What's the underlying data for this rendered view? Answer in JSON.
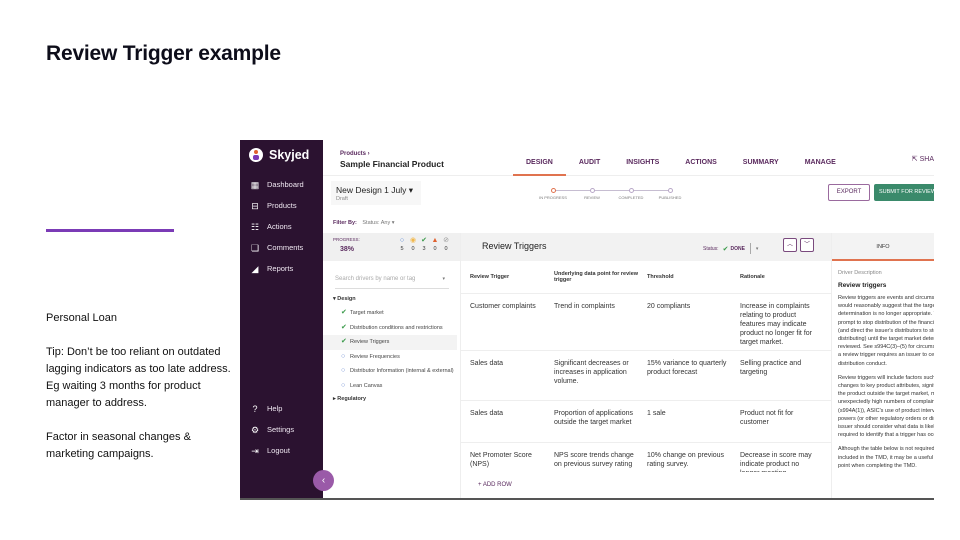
{
  "slide": {
    "title": "Review Trigger example",
    "accent_color": "#7b3bb6",
    "notes": [
      "Personal Loan",
      "Tip:  Don’t be too reliant on outdated lagging indicators  as too late address. Eg waiting 3 months for product manager to address.",
      "Factor in seasonal changes & marketing campaigns."
    ]
  },
  "app": {
    "brand": "Skyjed",
    "sidebar": {
      "items": [
        {
          "label": "Dashboard",
          "icon": "dashboard-icon"
        },
        {
          "label": "Products",
          "icon": "products-icon"
        },
        {
          "label": "Actions",
          "icon": "actions-icon"
        },
        {
          "label": "Comments",
          "icon": "comments-icon"
        },
        {
          "label": "Reports",
          "icon": "reports-icon"
        }
      ],
      "bottom_items": [
        {
          "label": "Help",
          "icon": "help-icon"
        },
        {
          "label": "Settings",
          "icon": "settings-icon"
        },
        {
          "label": "Logout",
          "icon": "logout-icon"
        }
      ],
      "collapse_glyph": "‹"
    },
    "header": {
      "breadcrumb": "Products ›",
      "product_name": "Sample Financial Product",
      "tabs": [
        "DESIGN",
        "AUDIT",
        "INSIGHTS",
        "ACTIONS",
        "SUMMARY",
        "MANAGE"
      ],
      "active_tab": "DESIGN",
      "share_label": "SHA"
    },
    "design": {
      "name": "New Design 1 July",
      "status": "Draft",
      "steps": [
        "IN PROGRESS",
        "REVIEW",
        "COMPLETED",
        "PUBLISHED"
      ],
      "current_step": "IN PROGRESS",
      "export_label": "EXPORT",
      "submit_label": "SUBMIT FOR REVIEW"
    },
    "filter": {
      "label": "Filter By:",
      "value": "Status: Any ▾"
    },
    "progress": {
      "label": "PROGRESS:",
      "value": "38%",
      "counts": [
        {
          "icon": "not-started-icon",
          "glyph": "○",
          "color": "#4a7fd4",
          "count": "5"
        },
        {
          "icon": "in-progress-icon",
          "glyph": "◉",
          "color": "#f2b84b",
          "count": "0"
        },
        {
          "icon": "done-icon",
          "glyph": "✔",
          "color": "#3a9a4a",
          "count": "3"
        },
        {
          "icon": "warning-icon",
          "glyph": "▲",
          "color": "#e0612f",
          "count": "0"
        },
        {
          "icon": "na-icon",
          "glyph": "⊘",
          "color": "#999999",
          "count": "0"
        }
      ]
    },
    "search": {
      "placeholder": "Search drivers by name or tag"
    },
    "tree": {
      "design_group": "Design",
      "design_items": [
        {
          "label": "Target market",
          "status": "done"
        },
        {
          "label": "Distribution conditions and restrictions",
          "status": "done"
        },
        {
          "label": "Review Triggers",
          "status": "done",
          "selected": true
        },
        {
          "label": "Review Frequencies",
          "status": "todo"
        },
        {
          "label": "Distributor Information (internal & external)",
          "status": "todo"
        },
        {
          "label": "Lean Canvas",
          "status": "todo"
        }
      ],
      "regulatory_group": "Regulatory"
    },
    "main": {
      "title": "Review Triggers",
      "status_label": "Status:",
      "status_value": "DONE",
      "columns": [
        "Review Trigger",
        "Underlying data point for review trigger",
        "Threshold",
        "Rationale"
      ],
      "rows": [
        [
          "Customer complaints",
          "Trend in complaints",
          "20 compliants",
          "Increase in complaints relating to product features may indicate product no longer fit for target market."
        ],
        [
          "Sales data",
          "Significant decreases or increases in application volume.",
          "15% variance to quarterly product forecast",
          "Selling practice and targeting"
        ],
        [
          "Sales data",
          "Proportion of applications outside the target market",
          "1 sale",
          "Product not fit for customer"
        ],
        [
          "Net Promoter Score (NPS)",
          "NPS score trends change on previous survey rating",
          "10% change on previous rating survey.",
          "Decrease in score may indicate product no longer meeting"
        ]
      ],
      "add_row_label": "+ ADD ROW"
    },
    "info": {
      "tab": "INFO",
      "label": "Driver Description",
      "title": "Review triggers",
      "paragraphs": [
        "Review triggers are events and circumstances that would reasonably suggest that the target market determination is no longer appropriate. They are a prompt to stop distribution of the financial product (and direct the issuer's distributors to stop distributing) until the target market determination is reviewed. See s994C(3)–(5) for circumstances where a review trigger requires an issuer to cease distribution conduct.",
        "Review triggers will include factors such as material changes to key product attributes, significant sales of the product outside the target market, material or unexpectedly high numbers of complaints (s994A(1)), ASIC's use of product intervention powers (or other regulatory orders or directions). An issuer should consider what data is likely to be required to identify that a trigger has occurred.",
        "Although the table below is not required to be included in the TMD, it may be a useful reference point when completing the TMD."
      ]
    }
  }
}
